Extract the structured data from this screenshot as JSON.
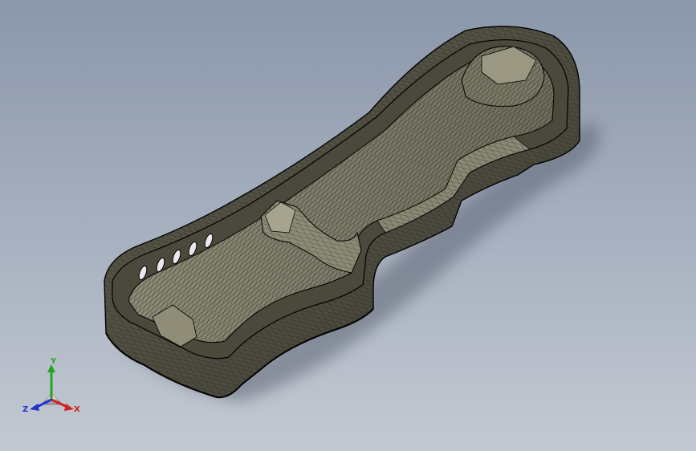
{
  "viewport": {
    "background_top": "#8b97aa",
    "background_bottom": "#c3c9d2",
    "model_color": "#6b6a58",
    "edge_color": "#111111"
  },
  "triad": {
    "x_label": "X",
    "y_label": "Y",
    "z_label": "Z",
    "x_color": "#d42020",
    "y_color": "#24a424",
    "z_color": "#2233cc"
  }
}
